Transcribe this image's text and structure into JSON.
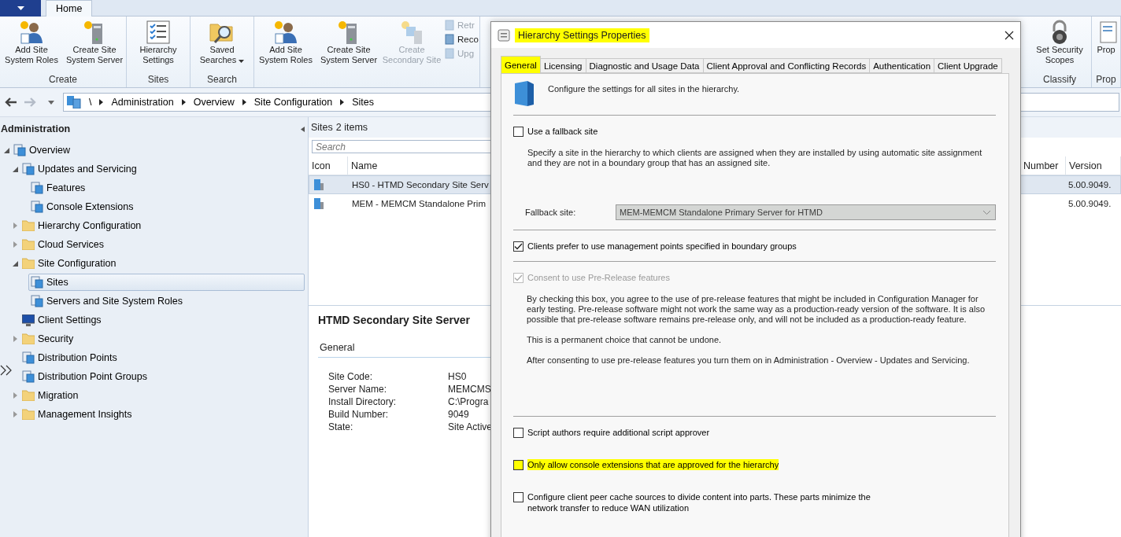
{
  "app_menu": {
    "tabs": [
      {
        "label": "Home",
        "selected": true
      }
    ]
  },
  "ribbon": {
    "groups": [
      {
        "label": "Create",
        "buttons": [
          {
            "kind": "roles",
            "label": "Add Site System Roles",
            "disabled": false
          },
          {
            "kind": "server",
            "label": "Create Site System Server",
            "disabled": false
          }
        ]
      },
      {
        "label": "Sites",
        "buttons": [
          {
            "kind": "settings",
            "label": "Hierarchy Settings",
            "disabled": false
          }
        ]
      },
      {
        "label": "Search",
        "buttons": [
          {
            "kind": "search",
            "label": "Saved Searches",
            "disabled": false,
            "dropdown": true
          }
        ]
      },
      {
        "buttons": [
          {
            "kind": "roles",
            "label": "Add Site System Roles",
            "disabled": false
          },
          {
            "kind": "server",
            "label": "Create Site System Server",
            "disabled": false
          },
          {
            "kind": "secondary",
            "label": "Create Secondary Site",
            "disabled": true
          }
        ],
        "small_buttons": [
          {
            "label": "Retr",
            "disabled": true
          },
          {
            "label": "Reco",
            "disabled": false
          },
          {
            "label": "Upg",
            "disabled": true
          }
        ]
      }
    ],
    "right_groups": [
      {
        "label": "Classify",
        "buttons": [
          {
            "kind": "lock",
            "label": "Set Security Scopes",
            "disabled": false
          }
        ]
      },
      {
        "label": "Prop",
        "buttons": [
          {
            "kind": "properties",
            "label": "Prop",
            "disabled": false
          }
        ]
      }
    ]
  },
  "address_bar": {
    "back_disabled": false,
    "forward_disabled": true,
    "path": [
      "\\",
      "Administration",
      "Overview",
      "Site Configuration",
      "Sites"
    ]
  },
  "navigation": {
    "title": "Administration",
    "items": [
      {
        "label": "Overview",
        "kind": "node",
        "expanded": true,
        "selected": false,
        "children": [
          {
            "label": "Updates and Servicing",
            "kind": "node",
            "expanded": true,
            "selected": false,
            "children": [
              {
                "label": "Features",
                "kind": "node",
                "selected": false
              },
              {
                "label": "Console Extensions",
                "kind": "node",
                "selected": false
              }
            ]
          },
          {
            "label": "Hierarchy Configuration",
            "kind": "folder",
            "expanded": false,
            "selected": false
          },
          {
            "label": "Cloud Services",
            "kind": "folder",
            "expanded": false,
            "selected": false
          },
          {
            "label": "Site Configuration",
            "kind": "folder",
            "expanded": true,
            "selected": false,
            "children": [
              {
                "label": "Sites",
                "kind": "node",
                "selected": true
              },
              {
                "label": "Servers and Site System Roles",
                "kind": "node",
                "selected": false
              }
            ]
          },
          {
            "label": "Client Settings",
            "kind": "monitor",
            "selected": false
          },
          {
            "label": "Security",
            "kind": "folder",
            "expanded": false,
            "selected": false
          },
          {
            "label": "Distribution Points",
            "kind": "node",
            "selected": false
          },
          {
            "label": "Distribution Point Groups",
            "kind": "node",
            "selected": false
          },
          {
            "label": "Migration",
            "kind": "folder",
            "expanded": false,
            "selected": false
          },
          {
            "label": "Management Insights",
            "kind": "folder",
            "expanded": false,
            "selected": false
          }
        ]
      }
    ]
  },
  "list": {
    "title": "Sites",
    "count": "2 items",
    "search": {
      "placeholder": "Search"
    },
    "columns": [
      "Icon",
      "Name",
      "Number",
      "Version"
    ],
    "rows": [
      {
        "name": "HS0 - HTMD Secondary Site Serv",
        "version": "5.00.9049.",
        "selected": true
      },
      {
        "name": "MEM - MEMCM Standalone Prim",
        "version": "5.00.9049.",
        "selected": false
      }
    ]
  },
  "details": {
    "title": "HTMD Secondary Site Server",
    "section": "General",
    "fields": [
      {
        "key": "Site Code:",
        "value": "HS0"
      },
      {
        "key": "Server Name:",
        "value": "MEMCMS"
      },
      {
        "key": "Install Directory:",
        "value": "C:\\Progra"
      },
      {
        "key": "Build Number:",
        "value": "9049"
      },
      {
        "key": "State:",
        "value": "Site Active"
      }
    ]
  },
  "dialog": {
    "title": "Hierarchy Settings Properties",
    "title_highlighted": true,
    "tabs": [
      {
        "label": "General",
        "selected": true,
        "highlighted": true
      },
      {
        "label": "Licensing",
        "selected": false,
        "highlighted": false
      },
      {
        "label": "Diagnostic and Usage Data",
        "selected": false,
        "highlighted": false
      },
      {
        "label": "Client Approval and Conflicting Records",
        "selected": false,
        "highlighted": false
      },
      {
        "label": "Authentication",
        "selected": false,
        "highlighted": false
      },
      {
        "label": "Client Upgrade",
        "selected": false,
        "highlighted": false
      }
    ],
    "header_text": "Configure the settings for all sites in the hierarchy.",
    "groups": [
      {
        "items": [
          {
            "kind": "checkbox",
            "label": "Use a fallback site",
            "checked": false,
            "disabled": false,
            "highlighted": false
          },
          {
            "kind": "hint",
            "text": "Specify a site in the hierarchy to which clients are assigned when they are installed by using automatic site assignment and they are not in a boundary group that has an assigned site."
          },
          {
            "kind": "select",
            "label": "Fallback site:",
            "value": "MEM-MEMCM Standalone Primary Server for HTMD",
            "disabled": true
          }
        ]
      },
      {
        "items": [
          {
            "kind": "checkbox",
            "label": "Clients prefer to use management points specified in boundary groups",
            "checked": true,
            "disabled": false,
            "highlighted": false
          }
        ]
      },
      {
        "items": [
          {
            "kind": "checkbox",
            "label": "Consent to use Pre-Release features",
            "checked": true,
            "disabled": true,
            "highlighted": false
          },
          {
            "kind": "notes",
            "paragraphs": [
              "By checking this box, you agree to the use of pre-release features that might be included in Configuration Manager for early testing. Pre-release software might not work the same way as a production-ready version of the software. It is also possible that pre-release software remains pre-release only, and will not be included as a production-ready feature.",
              "This is a permanent choice that cannot be undone.",
              "After consenting to use pre-release features you turn them on in Administration - Overview - Updates and Servicing."
            ]
          }
        ]
      },
      {
        "items": [
          {
            "kind": "checkbox",
            "label": "Script authors require additional script approver",
            "checked": false,
            "disabled": false,
            "highlighted": false
          },
          {
            "kind": "checkbox",
            "label": "Only allow console extensions that are approved for the hierarchy",
            "checked": false,
            "disabled": false,
            "highlighted": true
          },
          {
            "kind": "checkbox",
            "label": "Configure client peer cache sources to divide content into parts. These parts minimize the network transfer to reduce WAN utilization",
            "checked": false,
            "disabled": false,
            "highlighted": false
          }
        ]
      }
    ]
  }
}
